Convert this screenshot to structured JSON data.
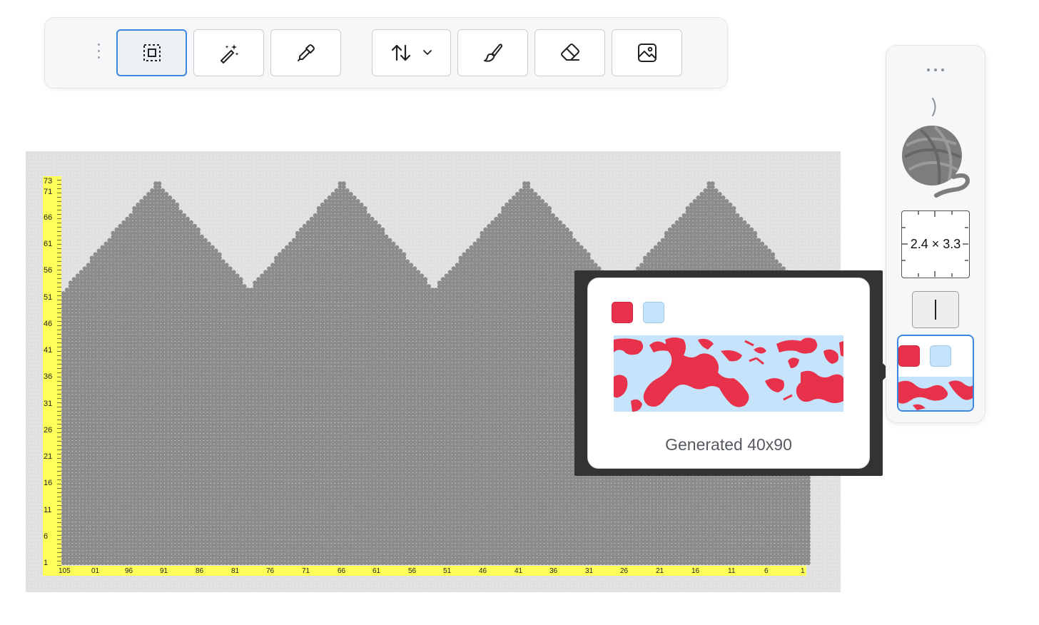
{
  "toolbar": {
    "tools": [
      {
        "id": "select",
        "icon": "selection-icon",
        "active": true
      },
      {
        "id": "magic-wand",
        "icon": "magic-wand-icon"
      },
      {
        "id": "eyedropper",
        "icon": "eyedropper-icon"
      },
      {
        "id": "sort",
        "icon": "sort-arrows-icon",
        "dropdown": "chevron-down-icon"
      },
      {
        "id": "brush",
        "icon": "brush-icon"
      },
      {
        "id": "eraser",
        "icon": "eraser-icon"
      },
      {
        "id": "image",
        "icon": "image-icon"
      }
    ]
  },
  "chart": {
    "row_labels": [
      "73",
      "71",
      "66",
      "61",
      "56",
      "51",
      "46",
      "41",
      "36",
      "31",
      "26",
      "21",
      "16",
      "11",
      "6",
      "1"
    ],
    "column_labels": [
      "105",
      "01",
      "96",
      "91",
      "86",
      "81",
      "76",
      "71",
      "66",
      "61",
      "56",
      "51",
      "46",
      "41",
      "36",
      "31",
      "26",
      "21",
      "16",
      "11",
      "6",
      "1"
    ],
    "stitch_color": "#8c8c8c",
    "ruler_color": "#ffff59"
  },
  "popover": {
    "colors": [
      "#e8314a",
      "#c5e4fb"
    ],
    "caption": "Generated 40x90"
  },
  "side_panel": {
    "more_icon": "more-dots-icon",
    "collapse_icon": "chevron-right-icon",
    "yarn_icon": "yarn-ball-icon",
    "gauge": "2.4 × 3.3",
    "line_tool_icon": "vertical-line-icon",
    "palette_colors": [
      "#e8314a",
      "#c5e4fb"
    ]
  }
}
